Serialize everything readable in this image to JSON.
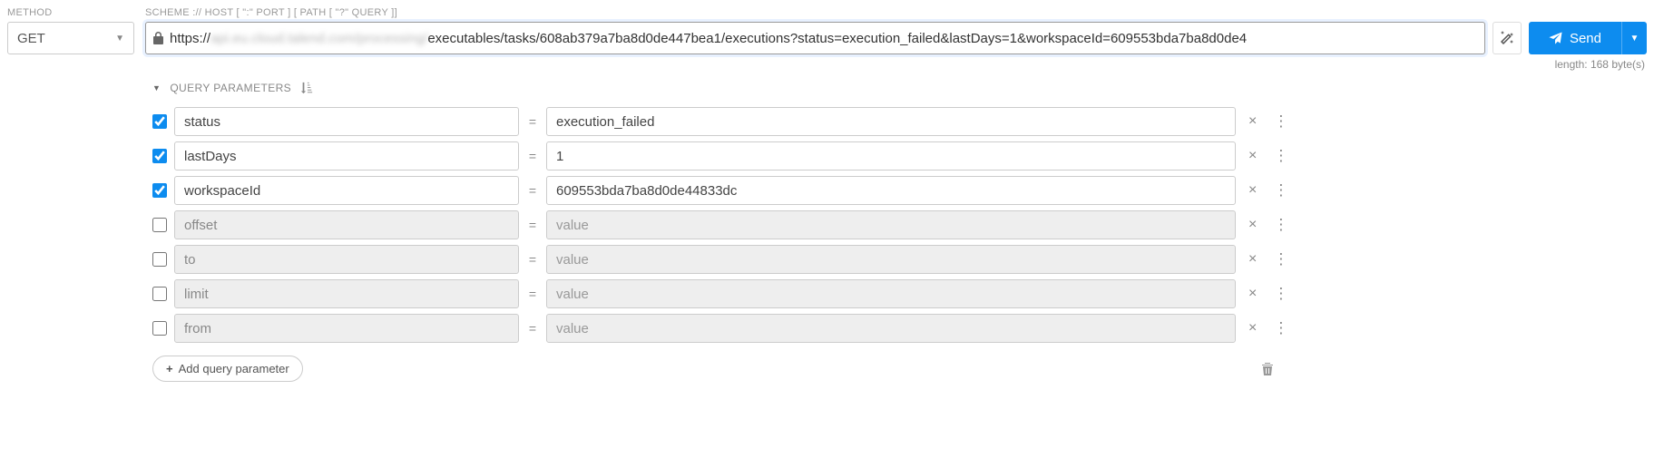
{
  "labels": {
    "method": "METHOD",
    "scheme": "SCHEME :// HOST [ \":\" PORT ] [ PATH [ \"?\" QUERY ]]"
  },
  "method": {
    "value": "GET"
  },
  "url": {
    "prefix": "https://",
    "blurred": "api.eu.cloud.talend.com/processing/",
    "rest": "executables/tasks/608ab379a7ba8d0de447bea1/executions?status=execution_failed&lastDays=1&workspaceId=609553bda7ba8d0de4"
  },
  "length_text": "length: 168 byte(s)",
  "send_label": "Send",
  "qp_header": "QUERY PARAMETERS",
  "params": [
    {
      "enabled": true,
      "name": "status",
      "value": "execution_failed",
      "placeholder": "value"
    },
    {
      "enabled": true,
      "name": "lastDays",
      "value": "1",
      "placeholder": "value"
    },
    {
      "enabled": true,
      "name": "workspaceId",
      "value": "609553bda7ba8d0de44833dc",
      "placeholder": "value"
    },
    {
      "enabled": false,
      "name": "offset",
      "value": "",
      "placeholder": "value"
    },
    {
      "enabled": false,
      "name": "to",
      "value": "",
      "placeholder": "value"
    },
    {
      "enabled": false,
      "name": "limit",
      "value": "",
      "placeholder": "value"
    },
    {
      "enabled": false,
      "name": "from",
      "value": "",
      "placeholder": "value"
    }
  ],
  "add_label": "Add query parameter"
}
